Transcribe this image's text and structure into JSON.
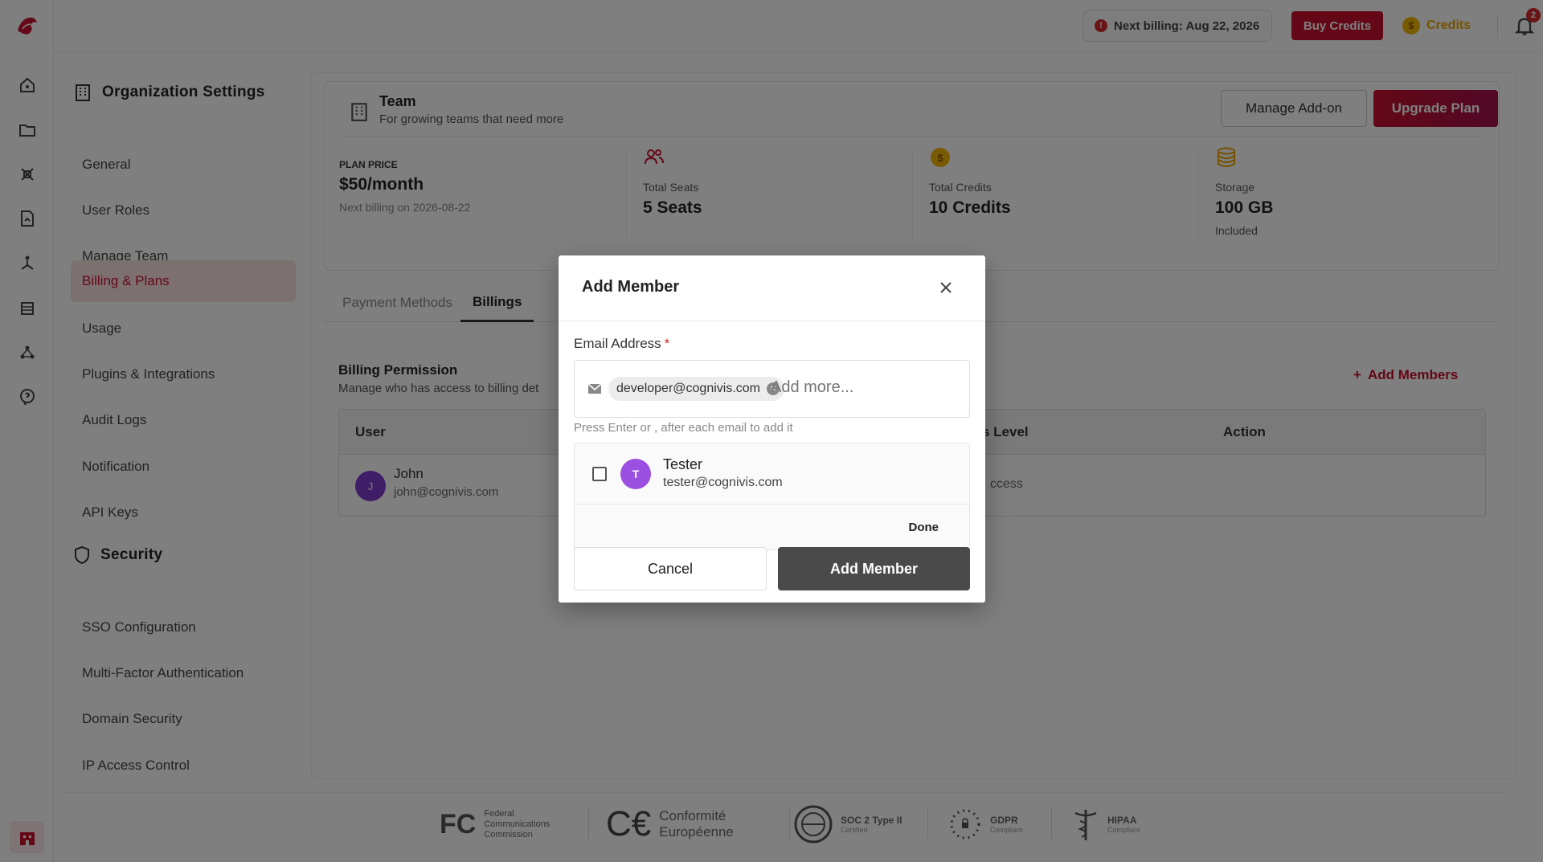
{
  "topbar": {
    "next_billing": "Next billing: Aug 22, 2026",
    "buy_credits": "Buy Credits",
    "credits_label": "Credits",
    "notification_count": "2"
  },
  "sidebar": {
    "org_heading": "Organization Settings",
    "org_items": [
      {
        "label": "General"
      },
      {
        "label": "User Roles"
      },
      {
        "label": "Manage Team"
      },
      {
        "label": "Billing & Plans",
        "active": true
      },
      {
        "label": "Usage"
      },
      {
        "label": "Plugins & Integrations"
      },
      {
        "label": "Audit Logs"
      },
      {
        "label": "Notification"
      },
      {
        "label": "API Keys"
      }
    ],
    "security_heading": "Security",
    "security_items": [
      {
        "label": "SSO Configuration"
      },
      {
        "label": "Multi-Factor Authentication"
      },
      {
        "label": "Domain Security"
      },
      {
        "label": "IP Access Control"
      }
    ]
  },
  "plan": {
    "name": "Team",
    "tagline": "For growing teams that need more",
    "manage_addon": "Manage Add-on",
    "upgrade": "Upgrade Plan",
    "price_label": "PLAN PRICE",
    "price": "$50/month",
    "next_billing": "Next billing on 2026-08-22",
    "seats_label": "Total Seats",
    "seats": "5 Seats",
    "credits_label": "Total Credits",
    "credits": "10 Credits",
    "storage_label": "Storage",
    "storage": "100 GB",
    "storage_sub": "Included"
  },
  "tabs": [
    {
      "label": "Payment Methods"
    },
    {
      "label": "Billings",
      "active": true
    }
  ],
  "billing_permission": {
    "heading": "Billing Permission",
    "subtitle": "Manage who has access to billing det",
    "add_members": "Add Members",
    "columns": [
      "User",
      "s Level",
      "Action"
    ],
    "rows": [
      {
        "initial": "J",
        "name": "John",
        "email": "john@cognivis.com",
        "access": "ccess"
      }
    ]
  },
  "footer": {
    "fcc": "Federal Communications Commission",
    "ce": "Conformité Européenne",
    "soc": "SOC 2 Type II",
    "soc_sub": "Certified",
    "gdpr": "GDPR",
    "gdpr_sub": "Compliant",
    "hipaa": "HIPAA",
    "hipaa_sub": "Compliant"
  },
  "modal": {
    "title": "Add Member",
    "email_label": "Email Address",
    "required_mark": "*",
    "chip": "developer@cognivis.com",
    "placeholder": "Add more...",
    "hint": "Press Enter or , after each email to add it",
    "suggestion": {
      "initial": "T",
      "name": "Tester",
      "email": "tester@cognivis.com"
    },
    "done": "Done",
    "cancel": "Cancel",
    "submit": "Add Member"
  },
  "colors": {
    "brand": "#c8102e",
    "active_bg": "#fbe0e3",
    "overlay": "rgba(0,0,0,0.5)",
    "submit": "#4a4a4a"
  }
}
